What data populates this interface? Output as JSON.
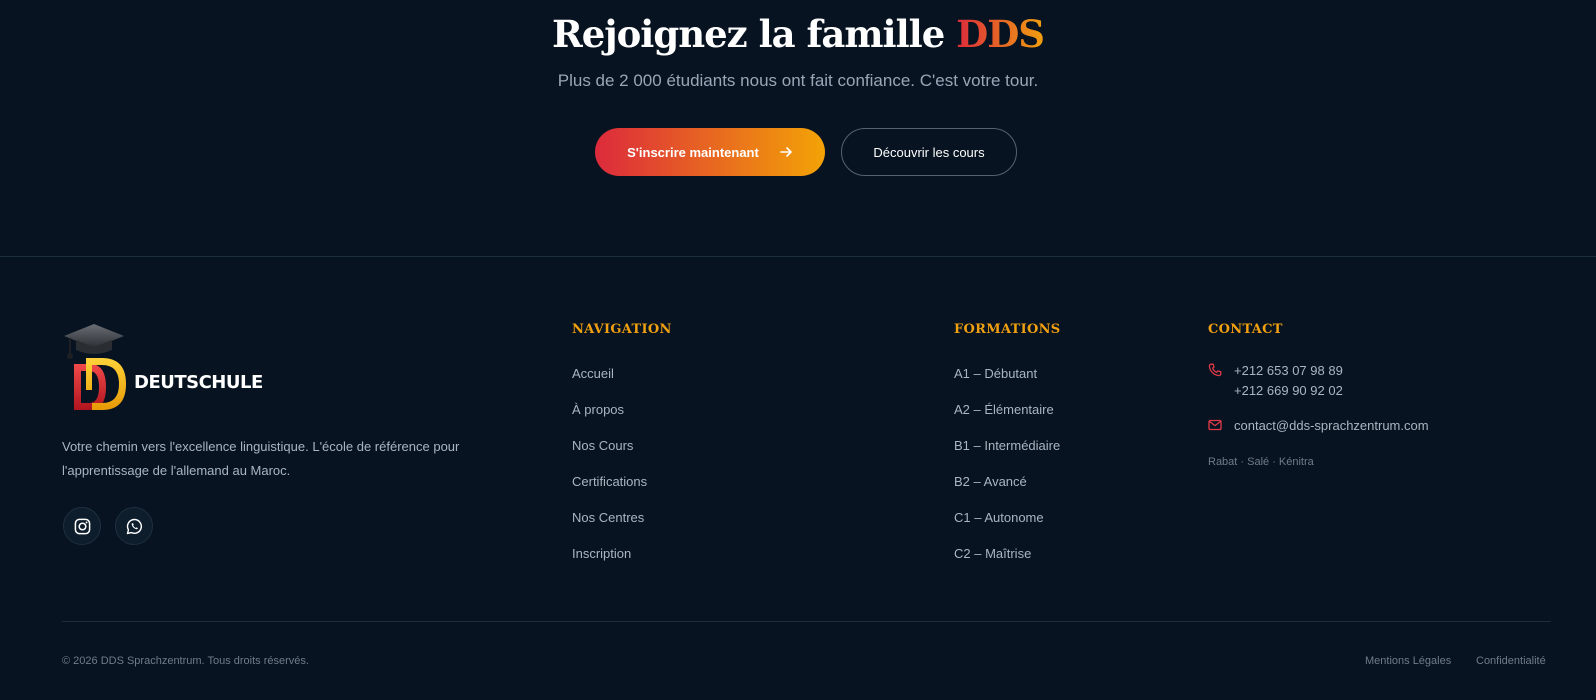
{
  "cta": {
    "title_prefix": "Rejoignez la famille ",
    "title_brand": "DDS",
    "subtitle": "Plus de 2 000 étudiants nous ont fait confiance. C'est votre tour.",
    "primary_button": "S'inscrire maintenant",
    "secondary_button": "Découvrir les cours"
  },
  "brand": {
    "wordmark": "DEUTSCHULE",
    "accent_red": "#dc2a3c",
    "accent_orange": "#f0a010",
    "background": "#071320"
  },
  "about": {
    "text": "Votre chemin vers l'excellence linguistique. L'école de référence pour l'apprentissage de l'allemand au Maroc.",
    "social": [
      "instagram-icon",
      "whatsapp-icon"
    ]
  },
  "navigation": {
    "title": "NAVIGATION",
    "items": [
      "Accueil",
      "À propos",
      "Nos Cours",
      "Certifications",
      "Nos Centres",
      "Inscription"
    ]
  },
  "formations": {
    "title": "FORMATIONS",
    "items": [
      "A1 – Débutant",
      "A2 – Élémentaire",
      "B1 – Intermédiaire",
      "B2 – Avancé",
      "C1 – Autonome",
      "C2 – Maîtrise"
    ]
  },
  "contact": {
    "title": "CONTACT",
    "phones": [
      "+212 653 07 98 89",
      "+212 669 90 92 02"
    ],
    "email": "contact@dds-sprachzentrum.com",
    "cities": "Rabat · Salé · Kénitra"
  },
  "footer": {
    "copyright": "© 2026 DDS Sprachzentrum. Tous droits réservés.",
    "mentions": "Mentions Légales",
    "confidentialite": "Confidentialité"
  }
}
